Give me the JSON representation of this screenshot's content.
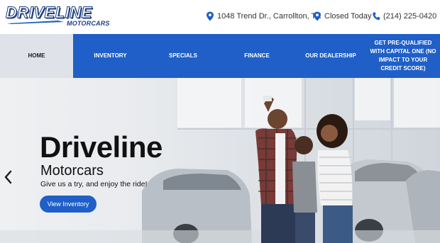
{
  "header": {
    "logo_main": "DRIVELINE",
    "logo_sub": "MOTORCARS",
    "address": "1048 Trend Dr., Carrollton, TX",
    "hours": "Closed Today",
    "phone": "(214) 225-0420",
    "icons": {
      "address": "map-pin-icon",
      "hours": "location-pin-icon",
      "phone": "phone-icon"
    }
  },
  "nav": {
    "items": [
      {
        "label": "HOME",
        "active": true
      },
      {
        "label": "INVENTORY",
        "active": false
      },
      {
        "label": "SPECIALS",
        "active": false
      },
      {
        "label": "FINANCE",
        "active": false
      },
      {
        "label": "OUR DEALERSHIP",
        "active": false
      },
      {
        "label": "GET PRE-QUALIFIED WITH CAPITAL ONE (NO IMPACT TO YOUR CREDIT SCORE)",
        "active": false
      }
    ]
  },
  "hero": {
    "title": "Driveline",
    "subtitle": "Motorcars",
    "tagline": "Give us a try, and enjoy the ride!",
    "button_label": "View Inventory",
    "prev_icon": "chevron-left-icon"
  },
  "colors": {
    "brand_blue": "#1f5fc7",
    "logo_dark": "#1f3f7f",
    "nav_active_bg": "#dfe3e9"
  }
}
